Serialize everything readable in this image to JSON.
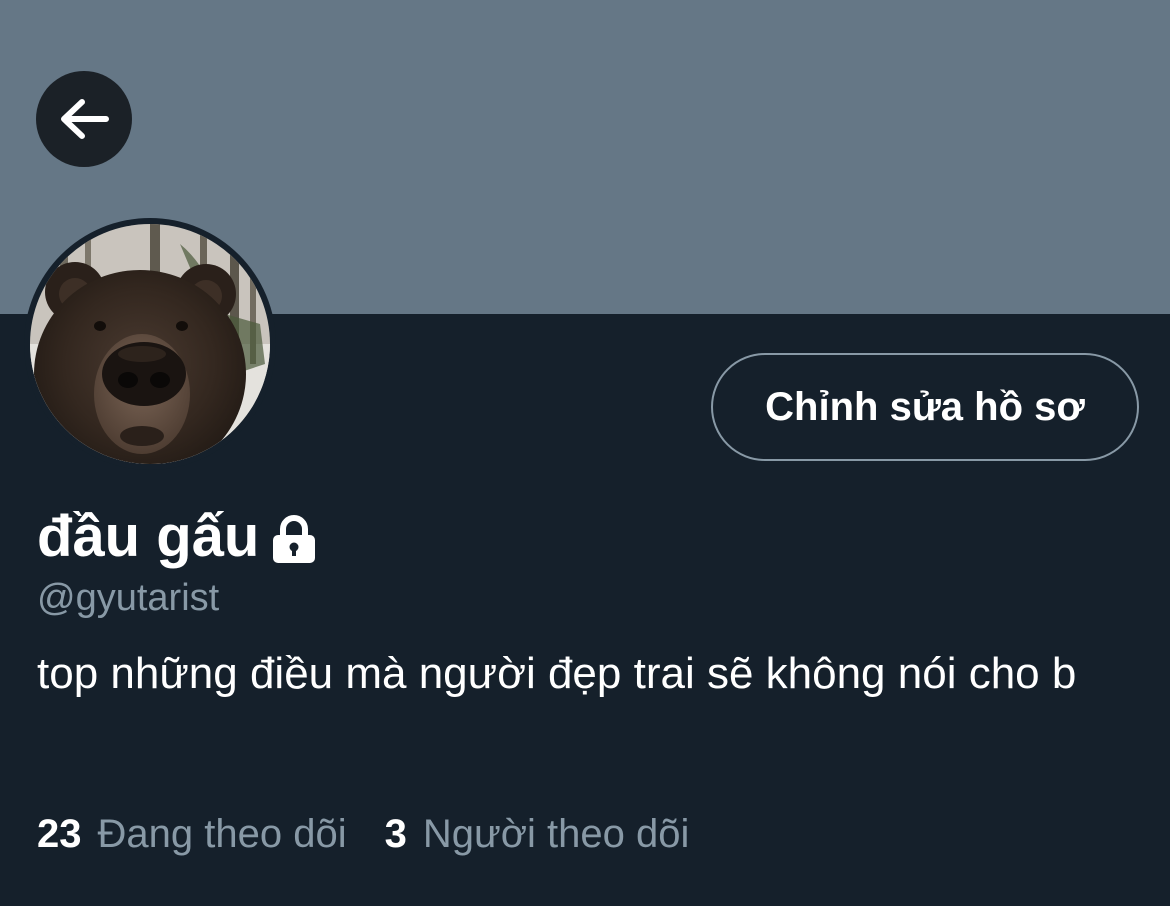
{
  "header": {
    "back_icon": "arrow-left-icon",
    "banner_color": "#657786"
  },
  "profile": {
    "avatar": "bear-face-photo",
    "edit_button_label": "Chỉnh sửa hồ sơ",
    "display_name": "đầu gấu",
    "lock_icon": "lock-icon",
    "handle": "@gyutarist",
    "bio": "top những điều mà người đẹp trai sẽ không nói cho b"
  },
  "stats": {
    "following_count": "23",
    "following_label": "Đang theo dõi",
    "followers_count": "3",
    "followers_label": "Người theo dõi"
  },
  "colors": {
    "background": "#15202b",
    "secondary_text": "#8899a6",
    "primary_text": "#ffffff"
  }
}
